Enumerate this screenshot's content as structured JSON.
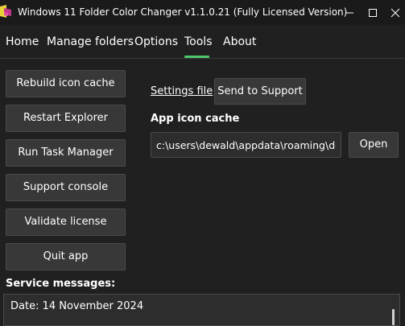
{
  "window": {
    "title": "Windows 11 Folder Color Changer v1.1.0.21 (Fully Licensed Version)"
  },
  "icons": {
    "app": "folder-color-app-icon",
    "minimize": "minimize-icon",
    "maximize": "maximize-icon",
    "close": "close-icon"
  },
  "menu": {
    "items": [
      {
        "label": "Home"
      },
      {
        "label": "Manage folders"
      },
      {
        "label": "Options"
      },
      {
        "label": "Tools",
        "active": true
      },
      {
        "label": "About"
      }
    ]
  },
  "tools": {
    "buttons": [
      {
        "label": "Rebuild icon cache"
      },
      {
        "label": "Restart Explorer"
      },
      {
        "label": "Run Task Manager"
      },
      {
        "label": "Support console"
      },
      {
        "label": "Validate license"
      },
      {
        "label": "Quit app"
      }
    ],
    "settings_file_link": "Settings file",
    "send_to_support": "Send to Support",
    "app_icon_cache_label": "App icon cache",
    "app_icon_cache_path": "c:\\users\\dewald\\appdata\\roaming\\del",
    "open_button": "Open"
  },
  "service": {
    "label": "Service messages:",
    "messages": [
      "Date: 14 November 2024"
    ]
  },
  "colors": {
    "accent": "#4cc76b",
    "background": "#202020",
    "button": "#383838"
  }
}
